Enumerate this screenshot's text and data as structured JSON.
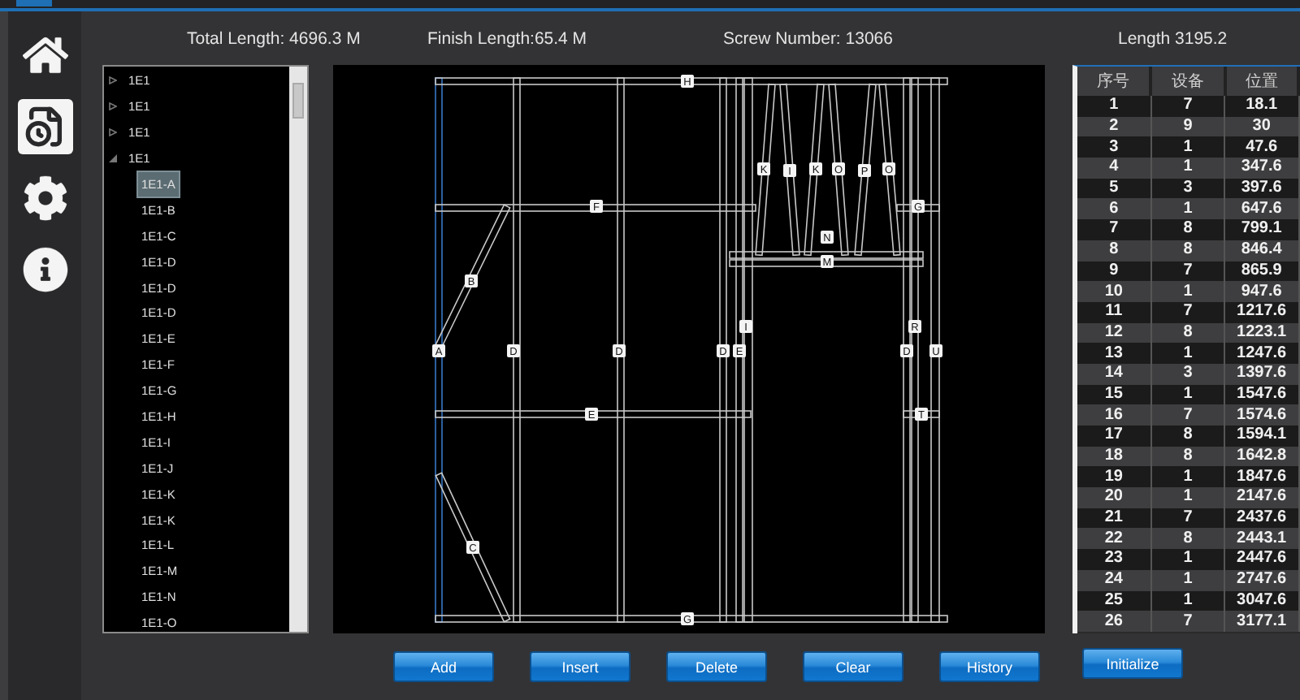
{
  "nav_items": [
    {
      "selected": false
    },
    {
      "selected": true
    },
    {
      "selected": false
    },
    {
      "selected": false
    }
  ],
  "stats": [
    "Total Length: 4696.3 M",
    "Finish Length:65.4 M",
    "Screw Number: 13066",
    "Length  3195.2"
  ],
  "tree": {
    "items": [
      {
        "label": "1E1",
        "expanded": false
      },
      {
        "label": "1E1",
        "expanded": false
      },
      {
        "label": "1E1",
        "expanded": false
      },
      {
        "label": "1E1",
        "expanded": true,
        "children": [
          {
            "label": "1E1-A",
            "selected": true
          },
          {
            "label": "1E1-B",
            "selected": false
          },
          {
            "label": "1E1-C",
            "selected": false
          },
          {
            "label": "1E1-D",
            "selected": false
          },
          {
            "label": "1E1-D",
            "selected": false
          },
          {
            "label": "1E1-D",
            "selected": false
          },
          {
            "label": "1E1-E",
            "selected": false
          },
          {
            "label": "1E1-F",
            "selected": false
          },
          {
            "label": "1E1-G",
            "selected": false
          },
          {
            "label": "1E1-H",
            "selected": false
          },
          {
            "label": "1E1-I",
            "selected": false
          },
          {
            "label": "1E1-J",
            "selected": false
          },
          {
            "label": "1E1-K",
            "selected": false
          },
          {
            "label": "1E1-K",
            "selected": false
          },
          {
            "label": "1E1-L",
            "selected": false
          },
          {
            "label": "1E1-M",
            "selected": false
          },
          {
            "label": "1E1-N",
            "selected": false
          },
          {
            "label": "1E1-O",
            "selected": false
          }
        ]
      }
    ]
  },
  "frame_labels": [
    "H",
    "F",
    "G",
    "K",
    "I",
    "K",
    "O",
    "P",
    "O",
    "N",
    "M",
    "B",
    "A",
    "D",
    "D",
    "D",
    "E",
    "D",
    "U",
    "I",
    "R",
    "E",
    "T",
    "C",
    "G"
  ],
  "table": {
    "columns": [
      "序号",
      "设备",
      "位置"
    ],
    "rows": [
      [
        "1",
        "7",
        "18.1"
      ],
      [
        "2",
        "9",
        "30"
      ],
      [
        "3",
        "1",
        "47.6"
      ],
      [
        "4",
        "1",
        "347.6"
      ],
      [
        "5",
        "3",
        "397.6"
      ],
      [
        "6",
        "1",
        "647.6"
      ],
      [
        "7",
        "8",
        "799.1"
      ],
      [
        "8",
        "8",
        "846.4"
      ],
      [
        "9",
        "7",
        "865.9"
      ],
      [
        "10",
        "1",
        "947.6"
      ],
      [
        "11",
        "7",
        "1217.6"
      ],
      [
        "12",
        "8",
        "1223.1"
      ],
      [
        "13",
        "1",
        "1247.6"
      ],
      [
        "14",
        "3",
        "1397.6"
      ],
      [
        "15",
        "1",
        "1547.6"
      ],
      [
        "16",
        "7",
        "1574.6"
      ],
      [
        "17",
        "8",
        "1594.1"
      ],
      [
        "18",
        "8",
        "1642.8"
      ],
      [
        "19",
        "1",
        "1847.6"
      ],
      [
        "20",
        "1",
        "2147.6"
      ],
      [
        "21",
        "7",
        "2437.6"
      ],
      [
        "22",
        "8",
        "2443.1"
      ],
      [
        "23",
        "1",
        "2447.6"
      ],
      [
        "24",
        "1",
        "2747.6"
      ],
      [
        "25",
        "1",
        "3047.6"
      ],
      [
        "26",
        "7",
        "3177.1"
      ]
    ]
  },
  "buttons": [
    "Add",
    "Insert",
    "Delete",
    "Clear",
    "History"
  ],
  "initialize_button": "Initialize"
}
